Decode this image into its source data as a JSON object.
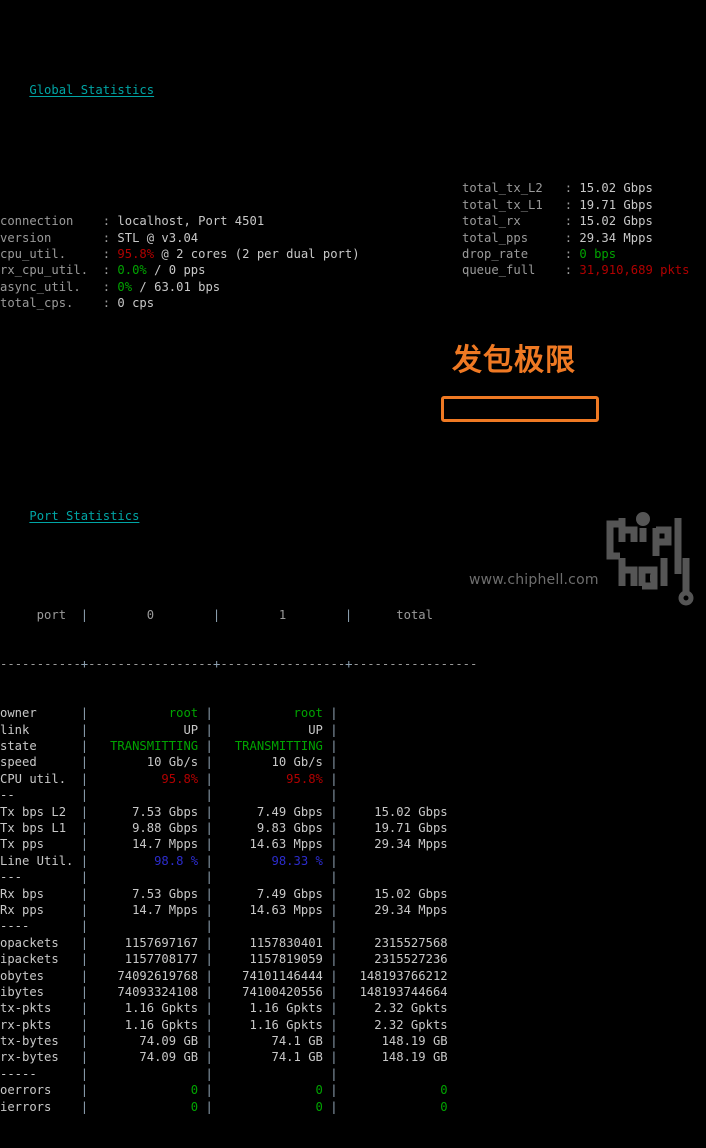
{
  "global": {
    "title": "Global Statistics",
    "left": [
      {
        "key": "connection",
        "value": "localhost, Port 4501",
        "color": "white"
      },
      {
        "key": "version",
        "value": "STL @ v3.04",
        "color": "white"
      },
      {
        "key": "cpu_util.",
        "value": "95.8%",
        "color": "red",
        "suffix": " @ 2 cores (2 per dual port)"
      },
      {
        "key": "rx_cpu_util.",
        "value": "0.0%",
        "color": "green",
        "suffix": " / 0 pps"
      },
      {
        "key": "async_util.",
        "value": "0%",
        "color": "green",
        "suffix": " / 63.01 bps"
      },
      {
        "key": "total_cps.",
        "value": "0 cps",
        "color": "white"
      }
    ],
    "right": [
      {
        "key": "total_tx_L2",
        "value": "15.02 Gbps",
        "color": "white"
      },
      {
        "key": "total_tx_L1",
        "value": "19.71 Gbps",
        "color": "white"
      },
      {
        "key": "total_rx",
        "value": "15.02 Gbps",
        "color": "white"
      },
      {
        "key": "total_pps",
        "value": "29.34 Mpps",
        "color": "white"
      },
      {
        "key": "drop_rate",
        "value": "0 bps",
        "color": "green"
      },
      {
        "key": "queue_full",
        "value": "31,910,689 pkts",
        "color": "red"
      }
    ]
  },
  "ports": {
    "title": "Port Statistics",
    "columns": [
      "port",
      "0",
      "1",
      "total"
    ],
    "separator": "-----------+-----------------+-----------------+-----------------",
    "rows": [
      {
        "label": "owner",
        "cells": [
          "root",
          "root",
          ""
        ],
        "color": "green"
      },
      {
        "label": "link",
        "cells": [
          "UP",
          "UP",
          ""
        ],
        "color": "white"
      },
      {
        "label": "state",
        "cells": [
          "TRANSMITTING",
          "TRANSMITTING",
          ""
        ],
        "color": "green"
      },
      {
        "label": "speed",
        "cells": [
          "10 Gb/s",
          "10 Gb/s",
          ""
        ],
        "color": "white"
      },
      {
        "label": "CPU util.",
        "cells": [
          "95.8%",
          "95.8%",
          ""
        ],
        "color": "red"
      },
      {
        "label": "--",
        "cells": [
          "",
          "",
          ""
        ],
        "color": "white",
        "rule": true
      },
      {
        "label": "Tx bps L2",
        "cells": [
          "7.53 Gbps",
          "7.49 Gbps",
          "15.02 Gbps"
        ],
        "color": "white"
      },
      {
        "label": "Tx bps L1",
        "cells": [
          "9.88 Gbps",
          "9.83 Gbps",
          "19.71 Gbps"
        ],
        "color": "white"
      },
      {
        "label": "Tx pps",
        "cells": [
          "14.7 Mpps",
          "14.63 Mpps",
          "29.34 Mpps"
        ],
        "color": "white"
      },
      {
        "label": "Line Util.",
        "cells": [
          "98.8 %",
          "98.33 %",
          ""
        ],
        "color": "blue"
      },
      {
        "label": "---",
        "cells": [
          "",
          "",
          ""
        ],
        "color": "white",
        "rule": true
      },
      {
        "label": "Rx bps",
        "cells": [
          "7.53 Gbps",
          "7.49 Gbps",
          "15.02 Gbps"
        ],
        "color": "white"
      },
      {
        "label": "Rx pps",
        "cells": [
          "14.7 Mpps",
          "14.63 Mpps",
          "29.34 Mpps"
        ],
        "color": "white"
      },
      {
        "label": "----",
        "cells": [
          "",
          "",
          ""
        ],
        "color": "white",
        "rule": true
      },
      {
        "label": "opackets",
        "cells": [
          "1157697167",
          "1157830401",
          "2315527568"
        ],
        "color": "white"
      },
      {
        "label": "ipackets",
        "cells": [
          "1157708177",
          "1157819059",
          "2315527236"
        ],
        "color": "white"
      },
      {
        "label": "obytes",
        "cells": [
          "74092619768",
          "74101146444",
          "148193766212"
        ],
        "color": "white"
      },
      {
        "label": "ibytes",
        "cells": [
          "74093324108",
          "74100420556",
          "148193744664"
        ],
        "color": "white"
      },
      {
        "label": "tx-pkts",
        "cells": [
          "1.16 Gpkts",
          "1.16 Gpkts",
          "2.32 Gpkts"
        ],
        "color": "white"
      },
      {
        "label": "rx-pkts",
        "cells": [
          "1.16 Gpkts",
          "1.16 Gpkts",
          "2.32 Gpkts"
        ],
        "color": "white"
      },
      {
        "label": "tx-bytes",
        "cells": [
          "74.09 GB",
          "74.1 GB",
          "148.19 GB"
        ],
        "color": "white"
      },
      {
        "label": "rx-bytes",
        "cells": [
          "74.09 GB",
          "74.1 GB",
          "148.19 GB"
        ],
        "color": "white"
      },
      {
        "label": "-----",
        "cells": [
          "",
          "",
          ""
        ],
        "color": "white",
        "rule": true
      },
      {
        "label": "oerrors",
        "cells": [
          "0",
          "0",
          "0"
        ],
        "color": "green"
      },
      {
        "label": "ierrors",
        "cells": [
          "0",
          "0",
          "0"
        ],
        "color": "green"
      }
    ]
  },
  "annotations": {
    "callout_text": "发包极限",
    "highlight_value": "29.34 Mpps",
    "accent_color": "#ef7923"
  },
  "watermark": {
    "url": "www.chiphell.com",
    "logo_name": "chiphell-logo"
  }
}
